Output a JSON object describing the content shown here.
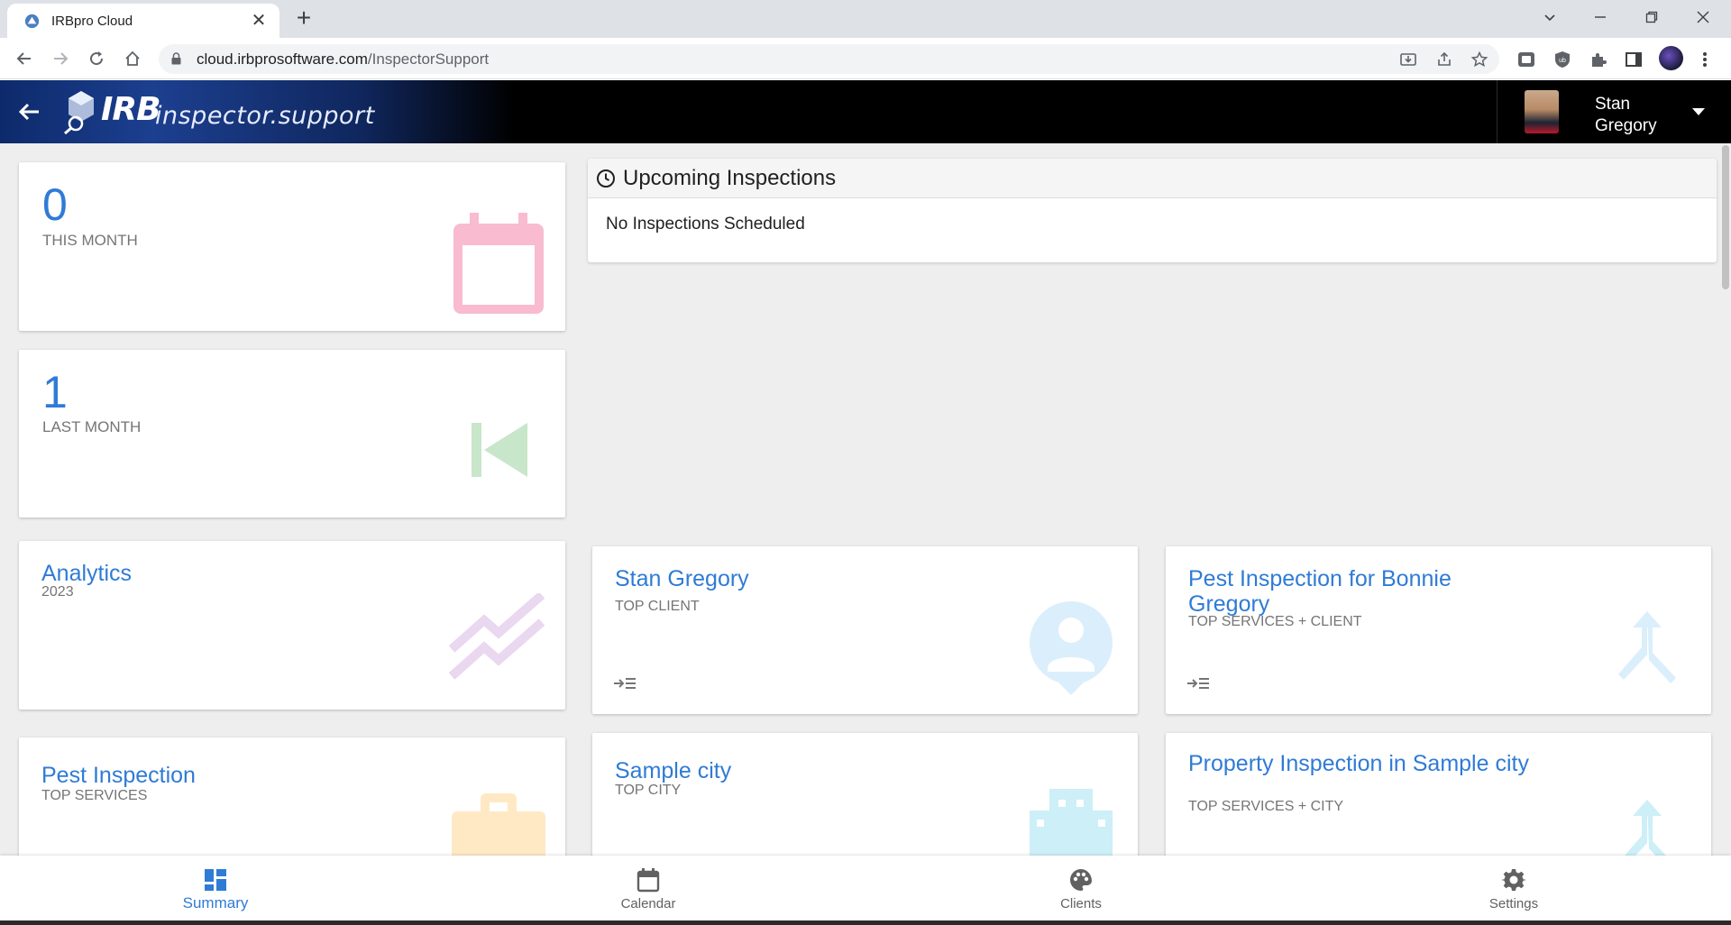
{
  "browser": {
    "tab_title": "IRBpro Cloud",
    "tab_close": "✕",
    "new_tab": "+",
    "url_host": "cloud.irbprosoftware.com",
    "url_path": "/InspectorSupport",
    "window_controls": [
      "chevron-down",
      "minimize",
      "restore",
      "close"
    ]
  },
  "app_header": {
    "logo_irb": "IRB",
    "logo_text": "inspector.support",
    "user_name": "Stan Gregory"
  },
  "stats": {
    "this_month": {
      "value": "0",
      "label": "THIS MONTH",
      "icon": "calendar-icon",
      "color": "#f8bbd0"
    },
    "last_month": {
      "value": "1",
      "label": "LAST MONTH",
      "icon": "skip-previous-icon",
      "color": "#c8e6c9"
    }
  },
  "upcoming": {
    "title": "Upcoming Inspections",
    "empty_message": "No Inspections Scheduled"
  },
  "cards": {
    "analytics": {
      "title": "Analytics",
      "subtitle": "2023",
      "icon": "trending-icon",
      "color": "#ead7f0"
    },
    "top_client": {
      "title": "Stan Gregory",
      "subtitle": "TOP CLIENT",
      "icon": "person-icon",
      "color": "#dbeefb"
    },
    "top_services_client": {
      "title": "Pest Inspection  for Bonnie Gregory",
      "subtitle": "TOP SERVICES + CLIENT",
      "icon": "merge-icon",
      "color": "#dbeefb"
    },
    "top_services": {
      "title": "Pest Inspection",
      "subtitle": "TOP SERVICES",
      "icon": "briefcase-icon",
      "color": "#ffe9c4"
    },
    "top_city": {
      "title": "Sample city",
      "subtitle": "TOP CITY",
      "icon": "building-icon",
      "color": "#cdeff7"
    },
    "top_services_city": {
      "title": "Property Inspection in Sample city",
      "subtitle": "TOP SERVICES + CITY",
      "icon": "merge-icon",
      "color": "#cdeff7"
    }
  },
  "bottom_nav": [
    {
      "label": "Summary",
      "icon": "dashboard-icon",
      "active": true
    },
    {
      "label": "Calendar",
      "icon": "calendar-icon",
      "active": false
    },
    {
      "label": "Clients",
      "icon": "palette-icon",
      "active": false
    },
    {
      "label": "Settings",
      "icon": "gear-icon",
      "active": false
    }
  ],
  "colors": {
    "accent": "#2f7bd6",
    "header_bg": "#000000",
    "page_bg": "#eeeeee"
  }
}
